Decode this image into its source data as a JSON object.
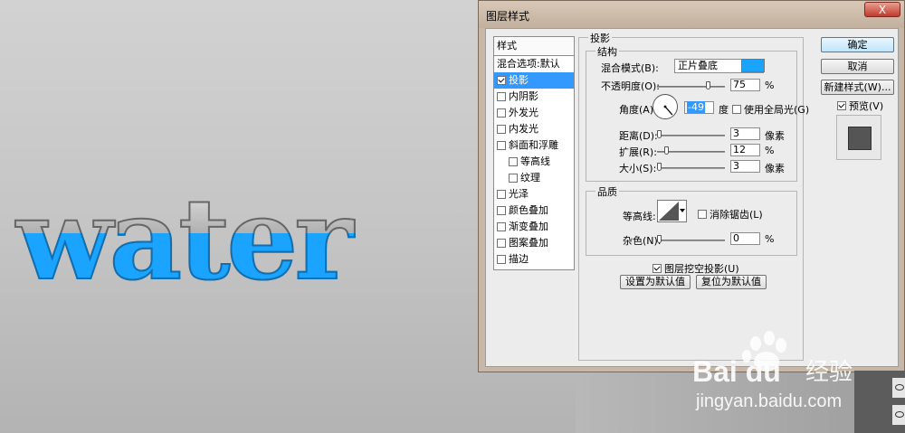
{
  "canvas_text": "water",
  "dialog": {
    "title": "图层样式",
    "close_label": "X",
    "stylelist": {
      "header": "样式",
      "items": [
        {
          "label": "混合选项:默认",
          "checkbox": false,
          "sub": false,
          "selected": false
        },
        {
          "label": "投影",
          "checkbox": true,
          "checked": true,
          "sub": false,
          "selected": true
        },
        {
          "label": "内阴影",
          "checkbox": true,
          "checked": false,
          "sub": false,
          "selected": false
        },
        {
          "label": "外发光",
          "checkbox": true,
          "checked": false,
          "sub": false,
          "selected": false
        },
        {
          "label": "内发光",
          "checkbox": true,
          "checked": false,
          "sub": false,
          "selected": false
        },
        {
          "label": "斜面和浮雕",
          "checkbox": true,
          "checked": false,
          "sub": false,
          "selected": false
        },
        {
          "label": "等高线",
          "checkbox": true,
          "checked": false,
          "sub": true,
          "selected": false
        },
        {
          "label": "纹理",
          "checkbox": true,
          "checked": false,
          "sub": true,
          "selected": false
        },
        {
          "label": "光泽",
          "checkbox": true,
          "checked": false,
          "sub": false,
          "selected": false
        },
        {
          "label": "颜色叠加",
          "checkbox": true,
          "checked": false,
          "sub": false,
          "selected": false
        },
        {
          "label": "渐变叠加",
          "checkbox": true,
          "checked": false,
          "sub": false,
          "selected": false
        },
        {
          "label": "图案叠加",
          "checkbox": true,
          "checked": false,
          "sub": false,
          "selected": false
        },
        {
          "label": "描边",
          "checkbox": true,
          "checked": false,
          "sub": false,
          "selected": false
        }
      ]
    },
    "drop_shadow": {
      "section_title": "投影",
      "structure_title": "结构",
      "blend_mode_label": "混合模式(B):",
      "blend_mode_value": "正片叠底",
      "shadow_color": "#1aa3ff",
      "opacity_label": "不透明度(O):",
      "opacity_value": "75",
      "opacity_unit": "%",
      "opacity_fraction": 0.75,
      "angle_label": "角度(A):",
      "angle_value": "-49",
      "angle_unit": "度",
      "global_light_label": "使用全局光(G)",
      "global_light_checked": false,
      "distance_label": "距离(D):",
      "distance_value": "3",
      "distance_unit": "像素",
      "spread_label": "扩展(R):",
      "spread_value": "12",
      "spread_unit": "%",
      "size_label": "大小(S):",
      "size_value": "3",
      "size_unit": "像素",
      "quality_title": "品质",
      "contour_label": "等高线:",
      "antialias_label": "消除锯齿(L)",
      "antialias_checked": false,
      "noise_label": "杂色(N):",
      "noise_value": "0",
      "noise_unit": "%",
      "knockout_label": "图层挖空投影(U)",
      "knockout_checked": true,
      "make_default_label": "设置为默认值",
      "reset_default_label": "复位为默认值"
    },
    "buttons": {
      "ok": "确定",
      "cancel": "取消",
      "new_style": "新建样式(W)...",
      "preview_label": "预览(V)",
      "preview_checked": true
    }
  },
  "watermark": {
    "brand": "Bai du",
    "brand_cn": "经验",
    "url": "jingyan.baidu.com"
  },
  "colors": {
    "accent": "#3399ff",
    "water_blue": "#1aa3ff"
  }
}
